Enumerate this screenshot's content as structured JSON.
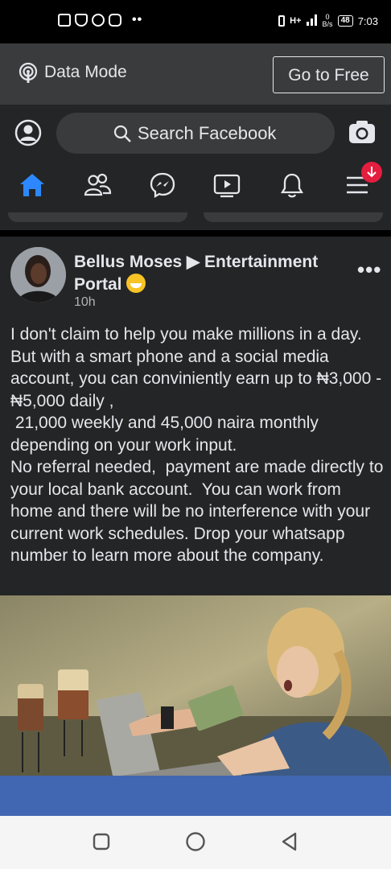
{
  "status_bar": {
    "left_icons": [
      "sms-icon",
      "vpn-shield-icon",
      "whatsapp-icon",
      "instagram-icon"
    ],
    "dots": "••",
    "network": "H+",
    "data_rate_top": "0",
    "data_rate_bottom": "B/s",
    "battery": "48",
    "time": "7:03"
  },
  "data_mode": {
    "label": "Data Mode",
    "button": "Go to Free"
  },
  "search": {
    "placeholder": "Search Facebook"
  },
  "nav": {
    "items": [
      "home-icon",
      "friends-icon",
      "messenger-icon",
      "watch-icon",
      "notifications-icon",
      "menu-icon"
    ],
    "active": "home-icon",
    "accent": "#2d88ff",
    "badge_color": "#e41e3f"
  },
  "post": {
    "author": "Bellus Moses ▶ Entertainment Portal",
    "time": "10h",
    "more": "•••",
    "text": "I don't claim to help you make millions in a day. But with a smart phone and a social media account, you can conviniently earn up to ₦3,000 - ₦5,000 daily ,\n 21,000 weekly and 45,000 naira monthly depending on your work input.\nNo referral needed,  payment are made directly to your local bank account.  You can work from home and there will be no interference with your current work schedules. Drop your whatsapp number to learn more about the company."
  },
  "colors": {
    "background": "#18191a",
    "surface": "#242526",
    "text": "#e4e6eb",
    "link_bar": "#4267b2"
  },
  "system_nav": [
    "recents-square-icon",
    "home-circle-icon",
    "back-triangle-icon"
  ]
}
